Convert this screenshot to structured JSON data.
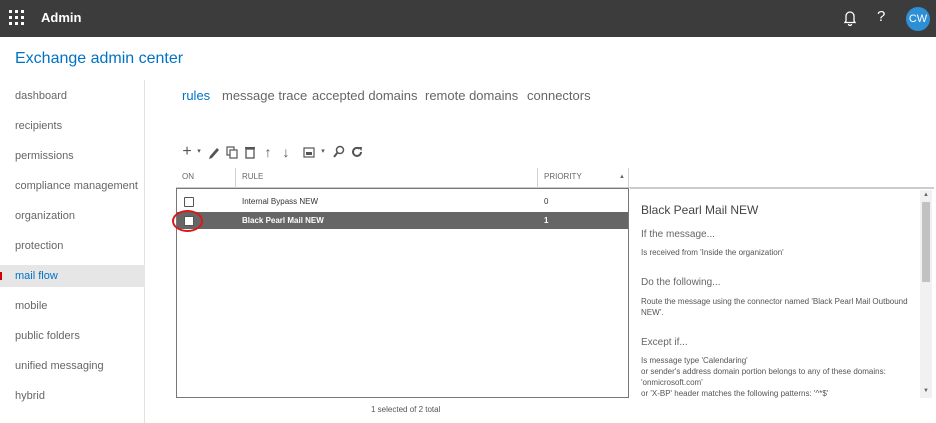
{
  "topbar": {
    "app_title": "Admin",
    "help_label": "?",
    "avatar_initials": "CW"
  },
  "page_title": "Exchange admin center",
  "nav": {
    "items": [
      {
        "label": "dashboard",
        "active": false
      },
      {
        "label": "recipients",
        "active": false
      },
      {
        "label": "permissions",
        "active": false
      },
      {
        "label": "compliance management",
        "active": false
      },
      {
        "label": "organization",
        "active": false
      },
      {
        "label": "protection",
        "active": false
      },
      {
        "label": "mail flow",
        "active": true
      },
      {
        "label": "mobile",
        "active": false
      },
      {
        "label": "public folders",
        "active": false
      },
      {
        "label": "unified messaging",
        "active": false
      },
      {
        "label": "hybrid",
        "active": false
      }
    ]
  },
  "tabs": [
    {
      "label": "rules",
      "active": true
    },
    {
      "label": "message trace",
      "active": false
    },
    {
      "label": "accepted domains",
      "active": false
    },
    {
      "label": "remote domains",
      "active": false
    },
    {
      "label": "connectors",
      "active": false
    }
  ],
  "toolbar": {
    "icons": [
      "add-icon",
      "edit-icon",
      "copy-icon",
      "delete-icon",
      "move-up-icon",
      "move-down-icon",
      "export-icon",
      "search-icon",
      "refresh-icon"
    ]
  },
  "table": {
    "columns": [
      "ON",
      "RULE",
      "PRIORITY"
    ],
    "sort_indicator": "▲",
    "rows": [
      {
        "rule": "Internal Bypass NEW",
        "priority": "0",
        "selected": false
      },
      {
        "rule": "Black Pearl Mail NEW",
        "priority": "1",
        "selected": true
      }
    ],
    "status": "1 selected of 2 total"
  },
  "detail": {
    "title": "Black Pearl Mail NEW",
    "if_heading": "If the message...",
    "if_text": "Is received from 'Inside the organization'",
    "do_heading": "Do the following...",
    "do_text": "Route the message using the connector named 'Black Pearl Mail Outbound NEW'.",
    "except_heading": "Except if...",
    "except_line1": "Is message type 'Calendaring'",
    "except_line2": "or sender's address domain portion belongs to any of these domains:",
    "except_line3": "'onmicrosoft.com'",
    "except_line4": "or 'X-BP' header matches the following patterns: '^*$'"
  },
  "colors": {
    "accent": "#0072c6",
    "topbar": "#3c3c3c",
    "selected_row": "#666666",
    "highlight": "#d61a1a"
  }
}
